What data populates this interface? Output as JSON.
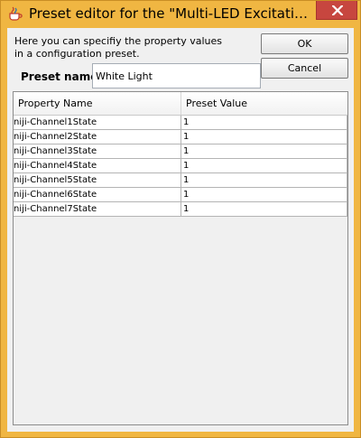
{
  "window": {
    "title": "Preset editor for the \"Multi-LED Excitation\" confi...",
    "app_icon": "java-cup-icon",
    "close_icon": "close-icon",
    "colors": {
      "frame": "#f0b642",
      "close_button": "#c7463f",
      "client_background": "#f0f0f0"
    }
  },
  "description": {
    "line1": "Here you can specifiy the property values",
    "line2": "in a configuration preset."
  },
  "preset": {
    "label": "Preset name:",
    "value": "White Light"
  },
  "buttons": {
    "ok": "OK",
    "cancel": "Cancel"
  },
  "table": {
    "headers": {
      "name": "Property Name",
      "value": "Preset Value"
    },
    "rows": [
      {
        "name": "niji-Channel1State",
        "value": "1"
      },
      {
        "name": "niji-Channel2State",
        "value": "1"
      },
      {
        "name": "niji-Channel3State",
        "value": "1"
      },
      {
        "name": "niji-Channel4State",
        "value": "1"
      },
      {
        "name": "niji-Channel5State",
        "value": "1"
      },
      {
        "name": "niji-Channel6State",
        "value": "1"
      },
      {
        "name": "niji-Channel7State",
        "value": "1"
      }
    ]
  }
}
